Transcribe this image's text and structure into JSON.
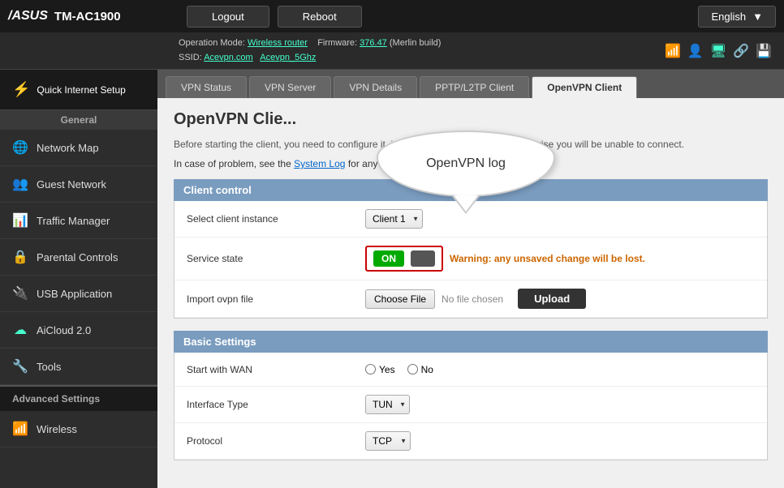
{
  "topbar": {
    "logo": "/ASUS",
    "model": "TM-AC1900",
    "logout_label": "Logout",
    "reboot_label": "Reboot",
    "lang_label": "English"
  },
  "infobar": {
    "operation_mode_label": "Operation Mode:",
    "operation_mode_value": "Wireless router",
    "firmware_label": "Firmware:",
    "firmware_value": "376.47",
    "build_label": "(Merlin build)",
    "ssid_label": "SSID:",
    "ssid_2g": "Acevpn.com",
    "ssid_5g": "Acevpn_5Ghz"
  },
  "sidebar": {
    "quick_setup_label": "Quick Internet Setup",
    "general_label": "General",
    "items": [
      {
        "id": "network-map",
        "label": "Network Map",
        "icon": "🌐"
      },
      {
        "id": "guest-network",
        "label": "Guest Network",
        "icon": "👥"
      },
      {
        "id": "traffic-manager",
        "label": "Traffic Manager",
        "icon": "📊"
      },
      {
        "id": "parental-controls",
        "label": "Parental Controls",
        "icon": "🔒"
      },
      {
        "id": "usb-application",
        "label": "USB Application",
        "icon": "🔌"
      },
      {
        "id": "aicloud",
        "label": "AiCloud 2.0",
        "icon": "☁"
      },
      {
        "id": "tools",
        "label": "Tools",
        "icon": "🔧"
      }
    ],
    "advanced_label": "Advanced Settings",
    "advanced_items": [
      {
        "id": "wireless",
        "label": "Wireless",
        "icon": "📶"
      }
    ]
  },
  "tabs": [
    {
      "id": "vpn-status",
      "label": "VPN Status"
    },
    {
      "id": "vpn-server",
      "label": "VPN Server"
    },
    {
      "id": "vpn-details",
      "label": "VPN Details"
    },
    {
      "id": "pptp-l2tp",
      "label": "PPTP/L2TP Client"
    },
    {
      "id": "openvpn-client",
      "label": "OpenVPN Client",
      "active": true
    }
  ],
  "page": {
    "title": "OpenVPN Clie...",
    "tooltip_text": "OpenVPN log",
    "desc": "Before starting the client, you need to configure it, including the required keys, otherwise you will be unable to connect.",
    "problem_note": "In case of problem, see the",
    "system_log_link": "System Log",
    "problem_note_end": "for any error message related to openvpn.",
    "client_control_label": "Client control",
    "select_instance_label": "Select client instance",
    "client_instance_value": "Client 1",
    "service_state_label": "Service state",
    "toggle_on_label": "ON",
    "warning_label": "Warning: any unsaved change will be lost.",
    "import_ovpn_label": "Import ovpn file",
    "choose_file_label": "Choose File",
    "no_file_label": "No file chosen",
    "upload_label": "Upload",
    "basic_settings_label": "Basic Settings",
    "start_with_wan_label": "Start with WAN",
    "yes_label": "Yes",
    "no_label": "No",
    "interface_type_label": "Interface Type",
    "interface_type_value": "TUN",
    "protocol_label": "Protocol",
    "protocol_value": "TCP"
  }
}
